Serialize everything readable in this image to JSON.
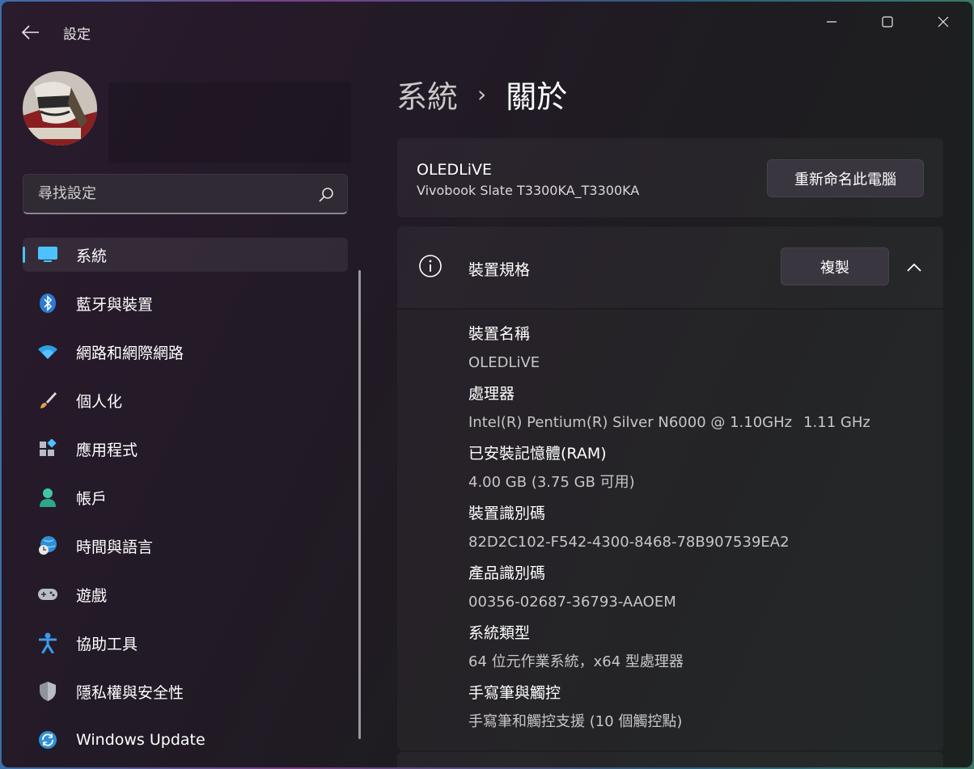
{
  "app": {
    "title": "設定"
  },
  "window_controls": [
    "minimize",
    "maximize",
    "close"
  ],
  "search": {
    "placeholder": "尋找設定"
  },
  "sidebar": {
    "items": [
      {
        "label": "系統",
        "icon": "monitor-icon",
        "selected": true
      },
      {
        "label": "藍牙與裝置",
        "icon": "bluetooth-icon"
      },
      {
        "label": "網路和網際網路",
        "icon": "wifi-icon"
      },
      {
        "label": "個人化",
        "icon": "brush-icon"
      },
      {
        "label": "應用程式",
        "icon": "apps-icon"
      },
      {
        "label": "帳戶",
        "icon": "person-icon"
      },
      {
        "label": "時間與語言",
        "icon": "globe-clock-icon"
      },
      {
        "label": "遊戲",
        "icon": "gamepad-icon"
      },
      {
        "label": "協助工具",
        "icon": "accessibility-icon"
      },
      {
        "label": "隱私權與安全性",
        "icon": "shield-icon"
      },
      {
        "label": "Windows Update",
        "icon": "update-icon"
      }
    ]
  },
  "breadcrumb": {
    "parent": "系統",
    "separator": "›",
    "current": "關於"
  },
  "device": {
    "name": "OLEDLiVE",
    "model": "Vivobook Slate T3300KA_T3300KA",
    "rename_label": "重新命名此電腦"
  },
  "specs": {
    "title": "裝置規格",
    "copy_label": "複製",
    "rows": [
      {
        "label": "裝置名稱",
        "value": "OLEDLiVE",
        "extra": ""
      },
      {
        "label": "處理器",
        "value": "Intel(R) Pentium(R) Silver N6000 @ 1.10GHz",
        "extra": "1.11 GHz"
      },
      {
        "label": "已安裝記憶體(RAM)",
        "value": "4.00 GB (3.75 GB 可用)",
        "extra": ""
      },
      {
        "label": "裝置識別碼",
        "value": "82D2C102-F542-4300-8468-78B907539EA2",
        "extra": ""
      },
      {
        "label": "產品識別碼",
        "value": "00356-02687-36793-AAOEM",
        "extra": ""
      },
      {
        "label": "系統類型",
        "value": "64 位元作業系統，x64 型處理器",
        "extra": ""
      },
      {
        "label": "手寫筆與觸控",
        "value": "手寫筆和觸控支援 (10 個觸控點)",
        "extra": ""
      }
    ]
  },
  "colors": {
    "accent": "#4cc2ff",
    "background": "#221a26"
  }
}
